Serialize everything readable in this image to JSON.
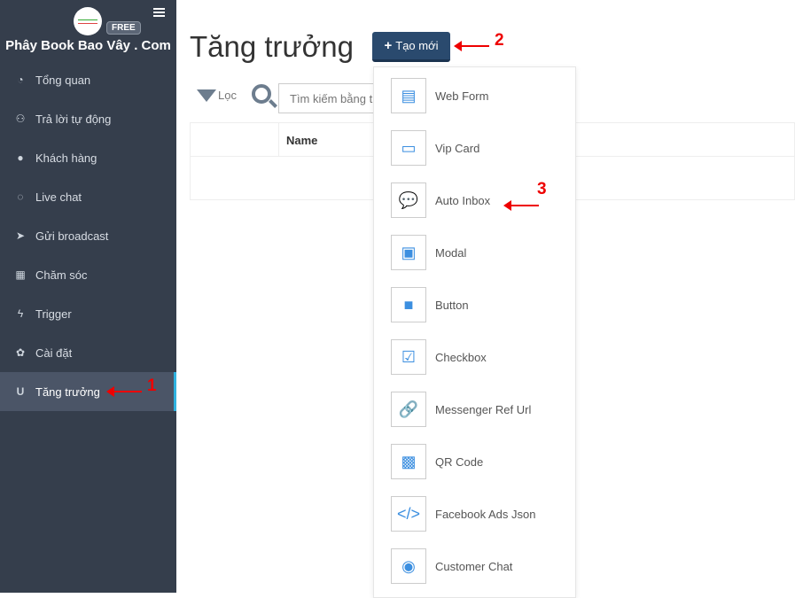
{
  "sidebar": {
    "badge": "FREE",
    "brand": "Phây Book Bao Vây . Com",
    "items": [
      {
        "label": "Tổng quan",
        "icon": "◔"
      },
      {
        "label": "Trả lời tự động",
        "icon": "⚇"
      },
      {
        "label": "Khách hàng",
        "icon": "●"
      },
      {
        "label": "Live chat",
        "icon": "◌"
      },
      {
        "label": "Gửi broadcast",
        "icon": "➤"
      },
      {
        "label": "Chăm sóc",
        "icon": "▦"
      },
      {
        "label": "Trigger",
        "icon": "ϟ"
      },
      {
        "label": "Cài đặt",
        "icon": "✿"
      },
      {
        "label": "Tăng trưởng",
        "icon": "U"
      }
    ]
  },
  "header": {
    "title": "Tăng trưởng",
    "create_label": "Tạo mới",
    "create_icon": "+"
  },
  "toolbar": {
    "filter_label": "Lọc",
    "search_placeholder": "Tìm kiếm bằng t"
  },
  "table": {
    "columns": [
      "",
      "Name"
    ]
  },
  "menu": {
    "items": [
      {
        "label": "Web Form",
        "icon": "▤"
      },
      {
        "label": "Vip Card",
        "icon": "▭"
      },
      {
        "label": "Auto Inbox",
        "icon": "💬"
      },
      {
        "label": "Modal",
        "icon": "▣"
      },
      {
        "label": "Button",
        "icon": "■"
      },
      {
        "label": "Checkbox",
        "icon": "☑"
      },
      {
        "label": "Messenger Ref Url",
        "icon": "🔗"
      },
      {
        "label": "QR Code",
        "icon": "▩"
      },
      {
        "label": "Facebook Ads Json",
        "icon": "</>"
      },
      {
        "label": "Customer Chat",
        "icon": "◉"
      }
    ]
  },
  "annotations": [
    "1",
    "2",
    "3"
  ]
}
